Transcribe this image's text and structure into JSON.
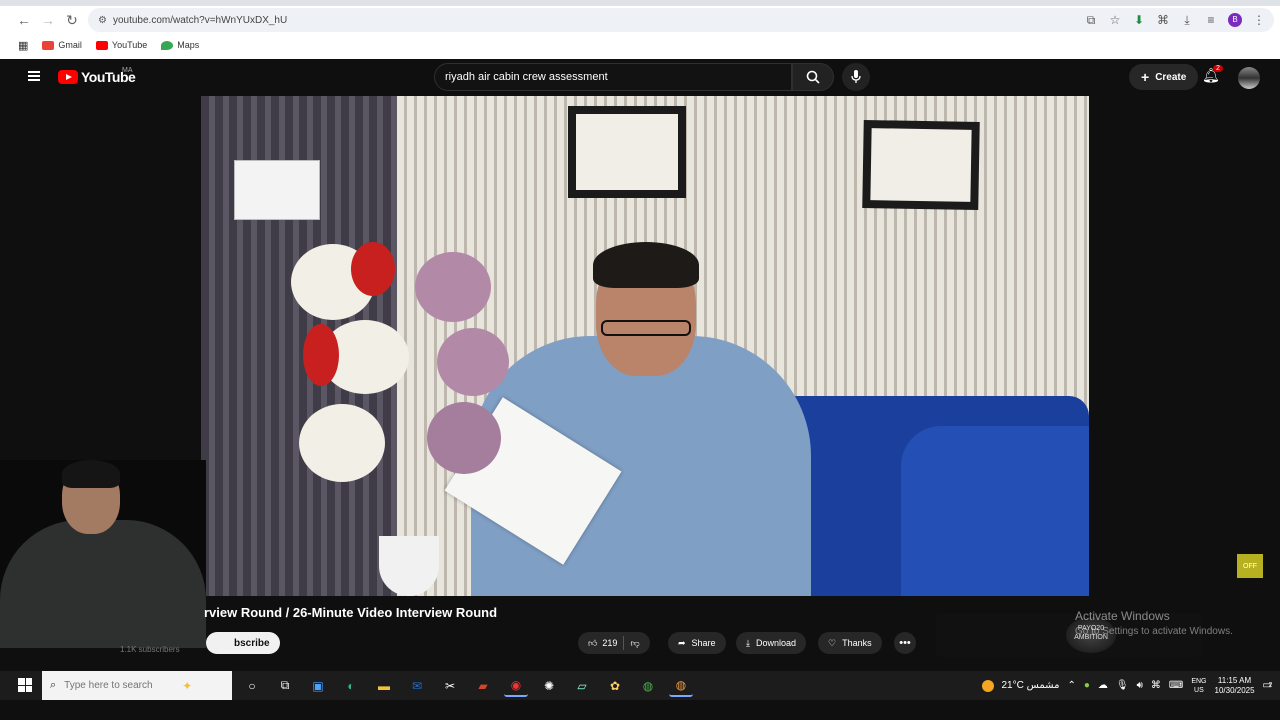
{
  "browser": {
    "url": "youtube.com/watch?v=hWnYUxDX_hU",
    "bookmarks": [
      {
        "label": "Gmail",
        "color": "#ea4335"
      },
      {
        "label": "YouTube",
        "color": "#ff0000"
      },
      {
        "label": "Maps",
        "color": "#34a853"
      }
    ]
  },
  "youtube": {
    "logo_text": "YouTube",
    "region": "MA",
    "search_query": "riyadh air cabin crew assessment",
    "create_label": "Create",
    "notification_count": "2"
  },
  "video": {
    "title": "rview Round / 26-Minute Video Interview Round",
    "subscribers": "1.1K subscribers",
    "subscribe_label": "bscribe",
    "like_count": "219",
    "share_label": "Share",
    "download_label": "Download",
    "thanks_label": "Thanks",
    "more_label": "•••"
  },
  "ad": {
    "logo_lines": [
      "PAYO20",
      "AMBITION"
    ]
  },
  "overlay": {
    "activate_title": "Activate Windows",
    "activate_sub": "Go to Settings to activate Windows.",
    "float_label": "OFF"
  },
  "taskbar": {
    "search_placeholder": "Type here to search",
    "weather": "21°C  مشمس",
    "lang_top": "ENG",
    "lang_bottom": "US",
    "time": "11:15 AM",
    "date": "10/30/2025",
    "notification_badge": "2"
  },
  "colors": {
    "yt_red": "#ff0000",
    "subscribe_bg": "#f1f1f1",
    "accent": "#7b2cbf"
  }
}
